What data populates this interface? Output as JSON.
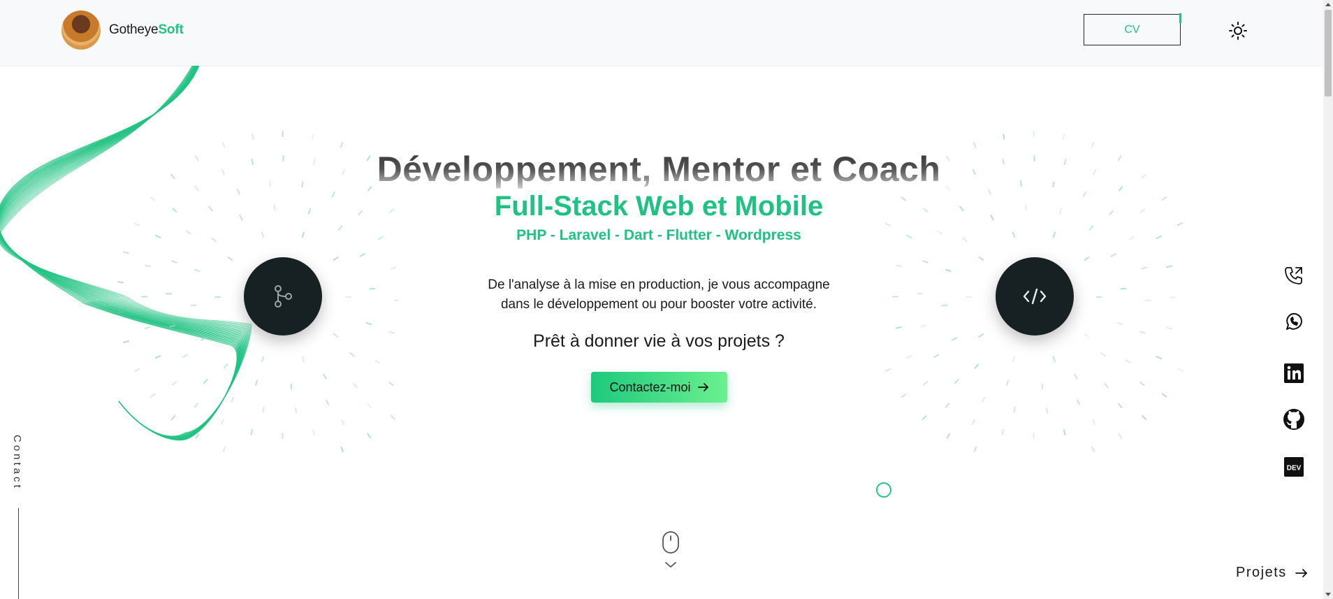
{
  "header": {
    "brand_name": "Gotheye",
    "brand_accent": "Soft",
    "cv_label": "CV",
    "theme_icon": "sun-icon"
  },
  "hero": {
    "title": "Développement, Mentor et Coach",
    "subtitle": "Full-Stack Web et Mobile",
    "stack": "PHP - Laravel - Dart - Flutter - Wordpress",
    "description_line1": "De l'analyse à la mise en production, je vous accompagne",
    "description_line2": "dans le développement ou pour booster votre activité.",
    "question": "Prêt à donner vie à vos projets ?",
    "cta_label": "Contactez-moi",
    "left_circle_icon": "git-branch-icon",
    "right_circle_icon": "code-icon"
  },
  "socials": [
    {
      "name": "phone",
      "icon": "phone-icon"
    },
    {
      "name": "whatsapp",
      "icon": "whatsapp-icon"
    },
    {
      "name": "linkedin",
      "icon": "linkedin-icon"
    },
    {
      "name": "github",
      "icon": "github-icon"
    },
    {
      "name": "dev",
      "icon": "dev-icon",
      "text": "DEV"
    }
  ],
  "side": {
    "contact_label": "Contact",
    "projects_label": "Projets"
  },
  "colors": {
    "accent": "#22c383",
    "dark": "#172124",
    "header_bg": "#f8f9fa"
  }
}
